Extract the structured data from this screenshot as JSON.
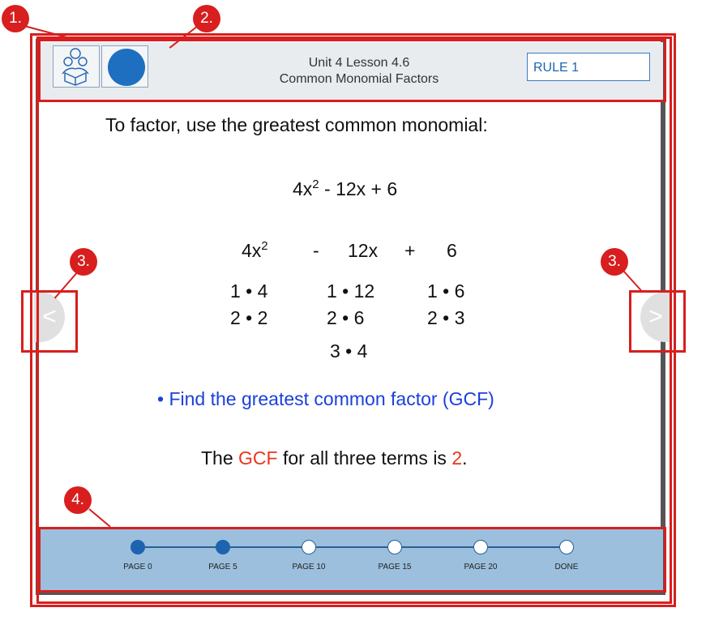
{
  "annotations": [
    "1.",
    "2.",
    "3.",
    "3.",
    "4."
  ],
  "header": {
    "lesson": "Unit 4 Lesson 4.6",
    "subtitle": "Common Monomial Factors",
    "rule_label": "RULE 1"
  },
  "content": {
    "intro": "To factor, use the greatest common monomial:",
    "expression": {
      "base": "4x",
      "exp": "2",
      "rest": " - 12x + 6"
    },
    "terms": [
      {
        "base": "4x",
        "exp": "2"
      },
      {
        "text": "-"
      },
      {
        "text": "12x"
      },
      {
        "text": "+"
      },
      {
        "text": "6"
      }
    ],
    "factor_rows": [
      [
        "1 • 4",
        "1 • 12",
        "1 • 6"
      ],
      [
        "2 • 2",
        "2 • 6",
        "2 • 3"
      ],
      [
        "",
        "3 • 4",
        ""
      ]
    ],
    "bullet": "• Find the greatest common factor (GCF)",
    "gcf_line": {
      "pre": "The ",
      "gcf": "GCF",
      "mid": " for all three terms is ",
      "value": "2",
      "end": "."
    }
  },
  "nav": {
    "prev_glyph": "<",
    "next_glyph": ">"
  },
  "progress": {
    "steps": [
      {
        "label": "PAGE 0",
        "done": true
      },
      {
        "label": "PAGE 5",
        "done": true
      },
      {
        "label": "PAGE 10",
        "done": false
      },
      {
        "label": "PAGE 15",
        "done": false
      },
      {
        "label": "PAGE 20",
        "done": false
      },
      {
        "label": "DONE",
        "done": false
      }
    ]
  },
  "colors": {
    "annotation": "#d81e1e",
    "accent": "#1e63b0",
    "highlight": "#e8361c",
    "bullet_blue": "#1a3fdc"
  }
}
